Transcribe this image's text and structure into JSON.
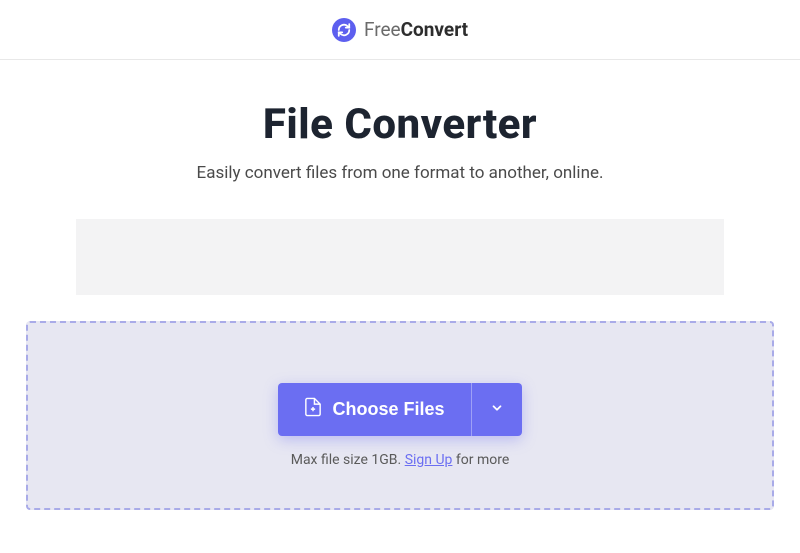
{
  "brand": {
    "name_light": "Free",
    "name_bold": "Convert"
  },
  "hero": {
    "title": "File Converter",
    "subtitle": "Easily convert files from one format to another, online."
  },
  "dropzone": {
    "choose_label": "Choose Files",
    "note_prefix": "Max file size 1GB. ",
    "signup_label": "Sign Up",
    "note_suffix": " for more"
  }
}
